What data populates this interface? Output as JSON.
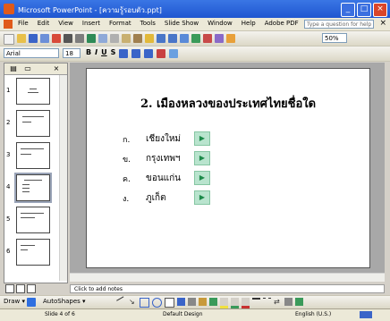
{
  "window": {
    "title": "Microsoft PowerPoint - [ความรู้รอบตัว.ppt]"
  },
  "menu": {
    "items": [
      "File",
      "Edit",
      "View",
      "Insert",
      "Format",
      "Tools",
      "Slide Show",
      "Window",
      "Help",
      "Adobe PDF"
    ],
    "help_placeholder": "Type a question for help"
  },
  "format_toolbar": {
    "font": "Arial",
    "size": "18",
    "bold": "B",
    "italic": "I",
    "underline": "U",
    "shadow": "S",
    "zoom": "50%"
  },
  "panel": {
    "tab_outline": "▤",
    "tab_slides": "▭",
    "close": "×"
  },
  "slides": [
    {
      "number": "1",
      "selected": false
    },
    {
      "number": "2",
      "selected": false
    },
    {
      "number": "3",
      "selected": false
    },
    {
      "number": "4",
      "selected": true
    },
    {
      "number": "5",
      "selected": false
    },
    {
      "number": "6",
      "selected": false
    }
  ],
  "slide": {
    "title": "2. เมืองหลวงของประเทศไทยชื่อใด",
    "choices": [
      {
        "label": "ก.",
        "text": "เชียงใหม่"
      },
      {
        "label": "ข.",
        "text": "กรุงเทพฯ"
      },
      {
        "label": "ค.",
        "text": "ขอนแก่น"
      },
      {
        "label": "ง.",
        "text": "ภูเก็ต"
      }
    ],
    "action_button": "▶"
  },
  "notes": {
    "placeholder": "Click to add notes"
  },
  "draw_toolbar": {
    "draw": "Draw ▾",
    "autoshapes": "AutoShapes ▾"
  },
  "status": {
    "slide": "Slide 4 of 6",
    "design": "Default Design",
    "language": "English (U.S.)"
  },
  "colors": {
    "title_bar": "#2a63d8",
    "action_button": "#b9e4ce",
    "selection": "#9aa4b8"
  }
}
